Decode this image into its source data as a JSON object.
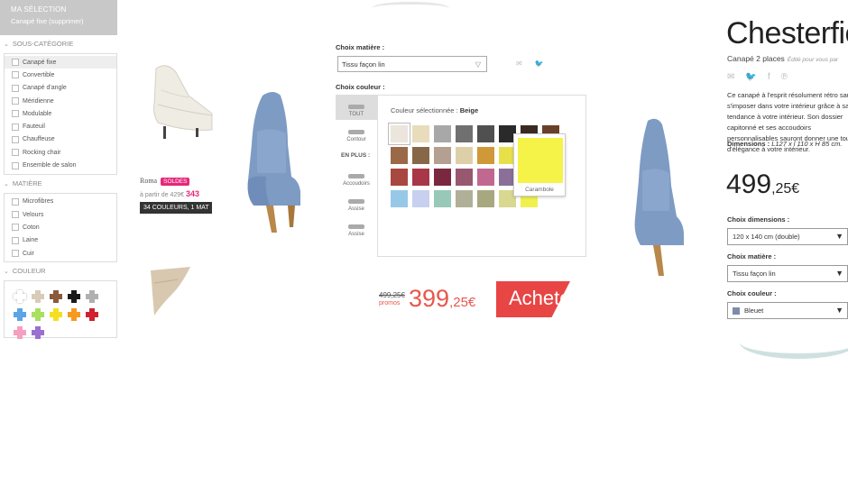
{
  "sidebar": {
    "selection_title": "MA SÉLECTION",
    "selection_item": "Canapé fixe (supprimer)",
    "sections": [
      {
        "title": "SOUS-CATÉGORIE",
        "options": [
          "Canapé fixe",
          "Convertible",
          "Canapé d'angle",
          "Méridienne",
          "Modulable",
          "Fauteuil",
          "Chauffeuse",
          "Rocking chair",
          "Ensemble de salon"
        ]
      },
      {
        "title": "MATIÈRE",
        "options": [
          "Microfibres",
          "Velours",
          "Coton",
          "Laine",
          "Cuir"
        ]
      }
    ],
    "color_title": "COULEUR",
    "colors": [
      "#ffffff",
      "#d8ccb8",
      "#8b5a3c",
      "#1a1a1a",
      "#b0b0b0",
      "#5ba4e6",
      "#a8e060",
      "#f5e020",
      "#f59a20",
      "#d02030",
      "#f5a0c0",
      "#9a70d0"
    ]
  },
  "card": {
    "name": "Roma",
    "badge": "SOLDES",
    "from_label": "à partir de 429€",
    "price": "343",
    "colors_bar": "34 COULEURS, 1 MAT"
  },
  "config": {
    "material_label": "Choix matière :",
    "material_value": "Tissu façon lin",
    "color_label": "Choix couleur :",
    "tabs": [
      "TOUT",
      "Contour"
    ],
    "extras_label": "EN PLUS :",
    "extra_tabs": [
      "Accoudoirs",
      "Assise",
      "Assise"
    ],
    "selected_prefix": "Couleur sélectionnée : ",
    "selected_name": "Beige",
    "swatches": [
      "#ebe5dc",
      "#e8dcbc",
      "#a8a8a8",
      "#707070",
      "#505050",
      "#2a2a2a",
      "#3a2a24",
      "#6a4028",
      "#9a6a48",
      "#866848",
      "#b4a090",
      "#ddd0a8",
      "#d09838",
      "#e8e048",
      "#f0e840",
      "#a87838",
      "#a84840",
      "#a83848",
      "#7a2840",
      "#985870",
      "#c06890",
      "#8a7098",
      "#6a5898",
      "#404060",
      "#98c8e8",
      "#c8d0f0",
      "#98c8b8",
      "#b0b098",
      "#a8a880",
      "#d8d890",
      "#f0f050",
      "#ffffff"
    ],
    "tooltip_color": "#f5f248",
    "tooltip_name": "Carambole",
    "old_price": "499,25€",
    "promo_label": "promos",
    "price_int": "399",
    "price_dec": ",25€",
    "buy_label": "Acheter"
  },
  "product": {
    "title": "Chesterfield",
    "subtitle": "Canapé 2 places",
    "edited": "Édité pour vous par",
    "share_icons": [
      "mail-icon",
      "twitter-icon",
      "facebook-icon",
      "pinterest-icon"
    ],
    "description": "Ce canapé à l'esprit résolument rétro saura s'imposer dans votre intérieur grâce à sa tendance à votre intérieur. Son dossier capitonné et ses accoudoirs personnalisables sauront donner une touche d'élégance à votre intérieur.",
    "dims_label": "Dimensions : ",
    "dims_value": "L127 x l 110 x H 85 cm.",
    "price_int": "499",
    "price_dec": ",25€",
    "dim_label": "Choix dimensions :",
    "dim_value": "120 x 140 cm (double)",
    "material_label": "Choix matière :",
    "material_value": "Tissu façon lin",
    "color_label": "Choix couleur :",
    "color_value": "Bleuet",
    "color_dot": "#7a8ea8"
  }
}
